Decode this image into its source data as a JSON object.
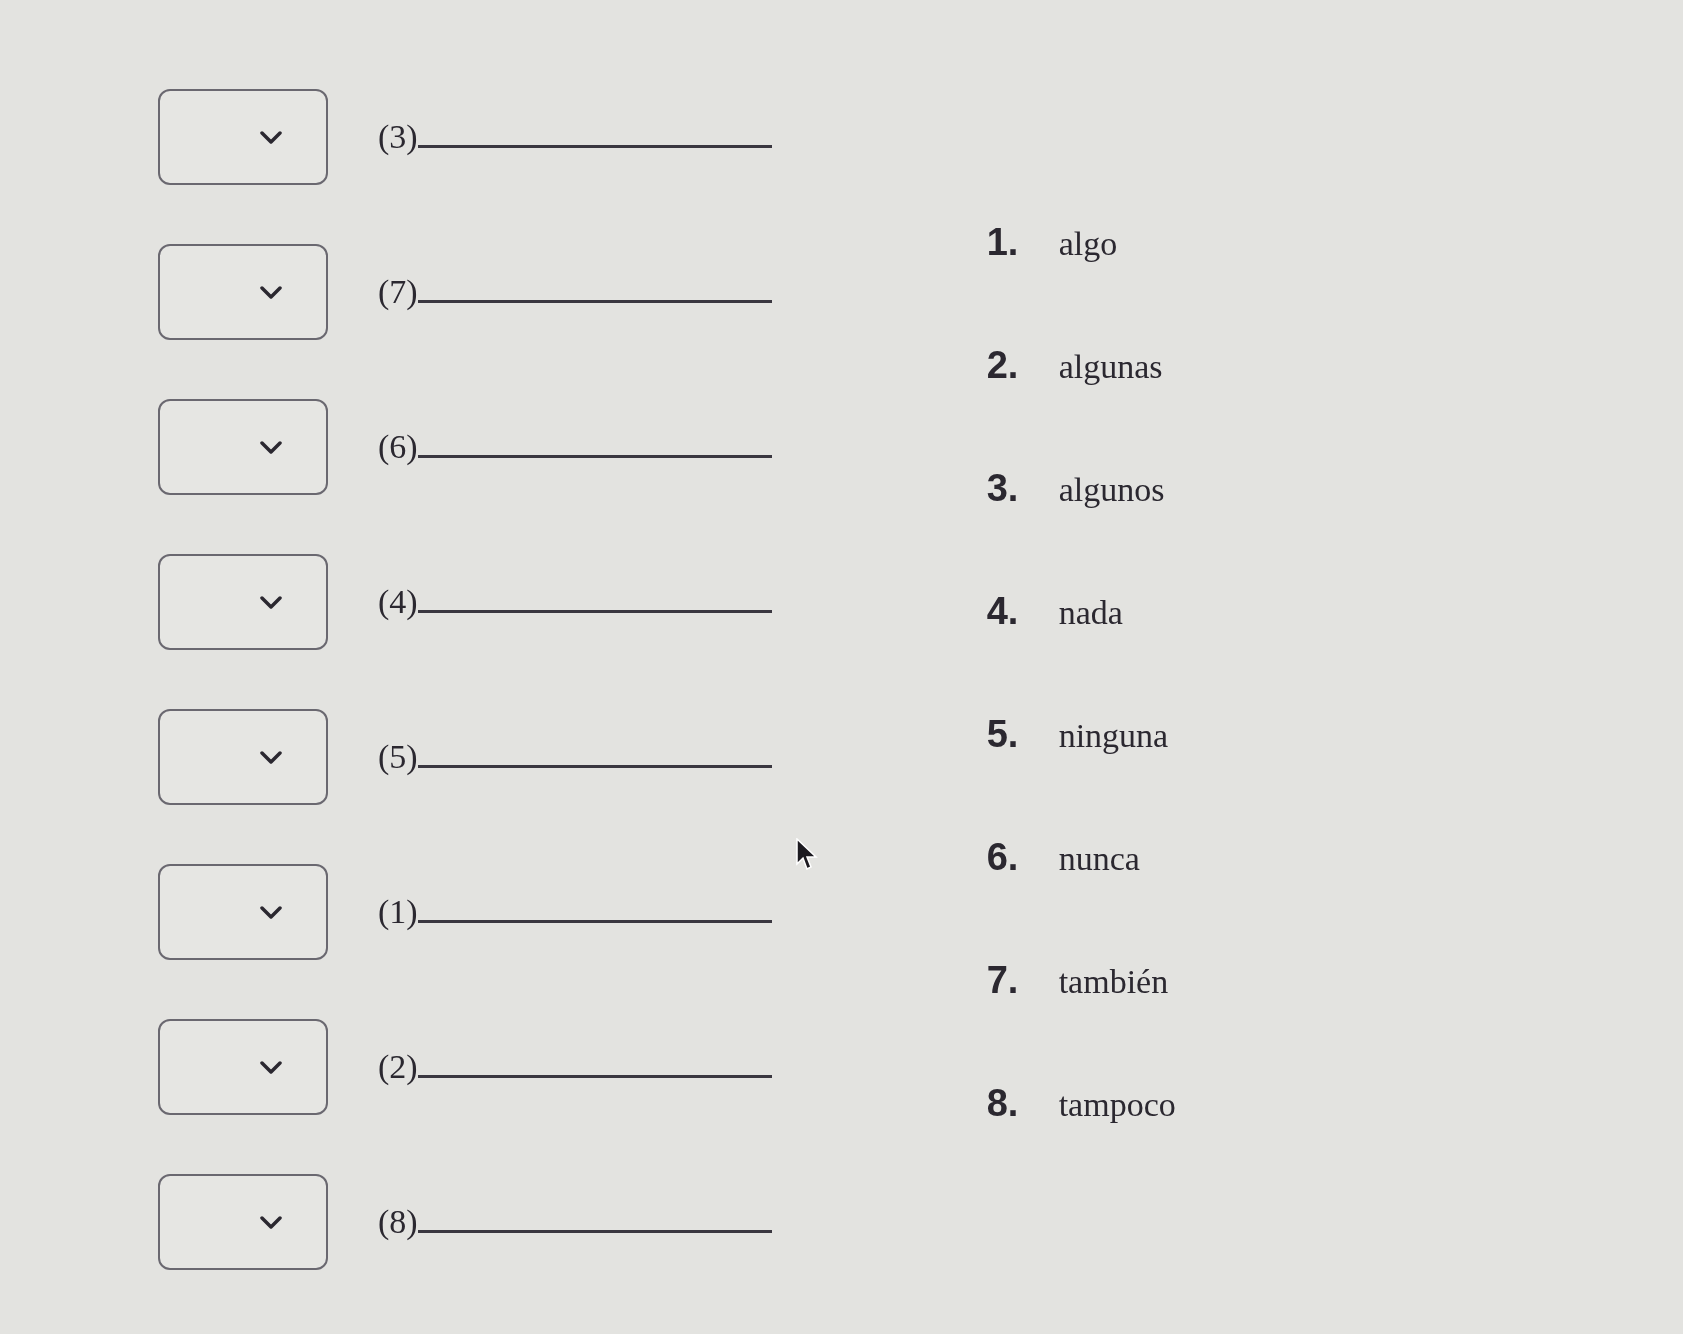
{
  "blanks": [
    {
      "label": "(3)"
    },
    {
      "label": "(7)"
    },
    {
      "label": "(6)"
    },
    {
      "label": "(4)"
    },
    {
      "label": "(5)"
    },
    {
      "label": "(1)"
    },
    {
      "label": "(2)"
    },
    {
      "label": "(8)"
    }
  ],
  "word_bank": [
    {
      "number": "1.",
      "word": "algo"
    },
    {
      "number": "2.",
      "word": "algunas"
    },
    {
      "number": "3.",
      "word": "algunos"
    },
    {
      "number": "4.",
      "word": "nada"
    },
    {
      "number": "5.",
      "word": "ninguna"
    },
    {
      "number": "6.",
      "word": "nunca"
    },
    {
      "number": "7.",
      "word": "también"
    },
    {
      "number": "8.",
      "word": "tampoco"
    }
  ]
}
